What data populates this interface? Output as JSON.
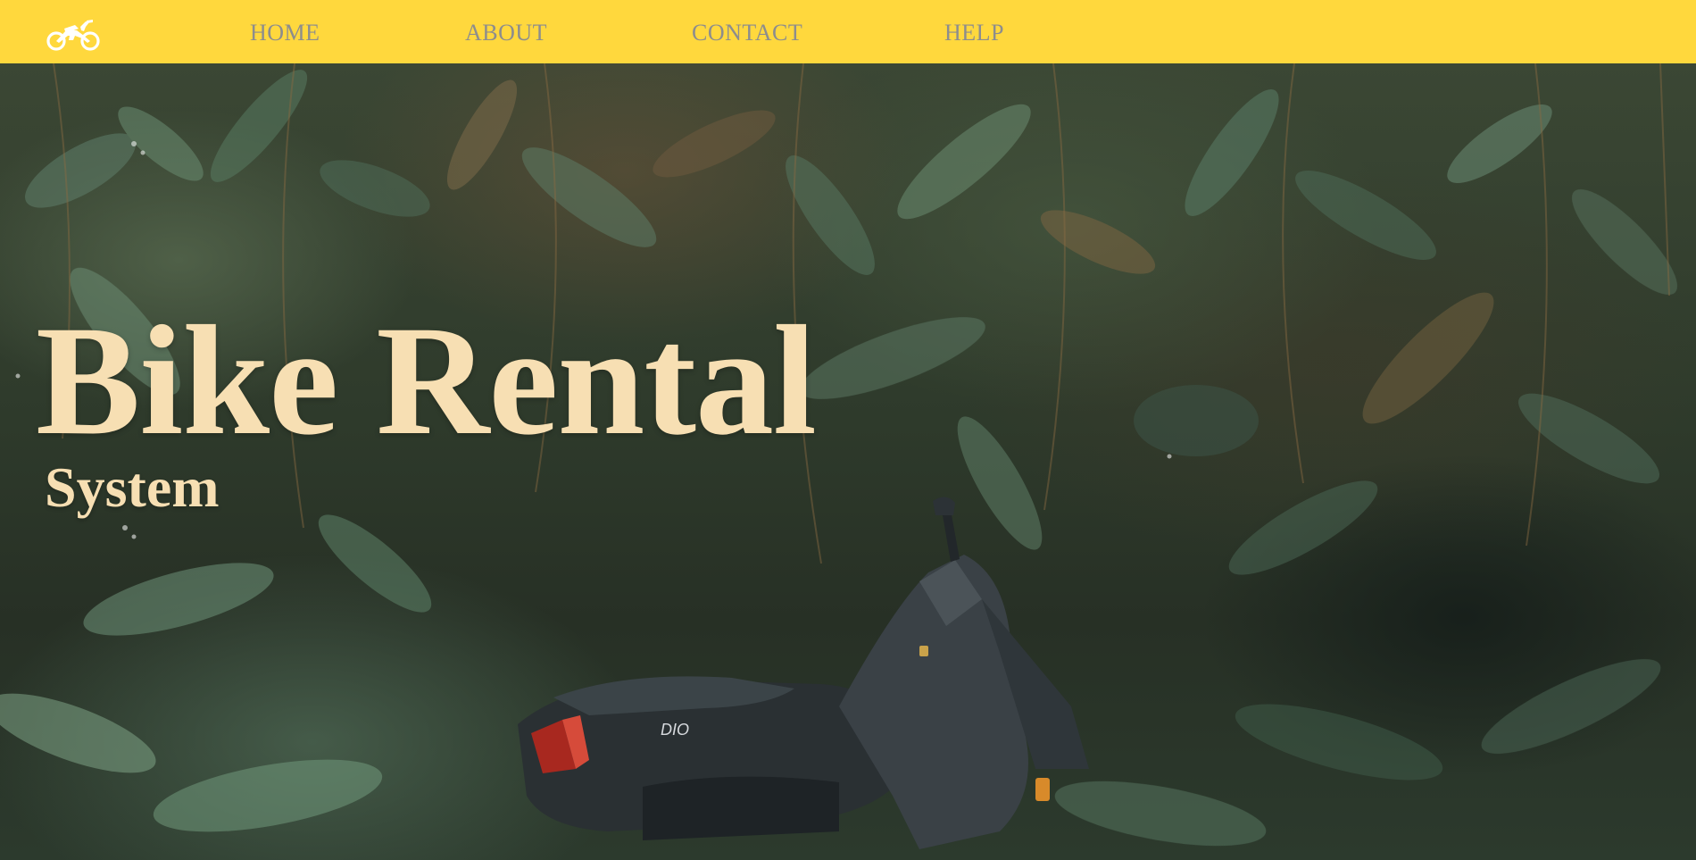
{
  "nav": {
    "logo_icon": "motorbike-icon",
    "items": [
      {
        "label": "HOME"
      },
      {
        "label": "ABOUT"
      },
      {
        "label": "CONTACT"
      },
      {
        "label": "HELP"
      }
    ]
  },
  "hero": {
    "title": "Bike Rental",
    "subtitle": "System",
    "background": "jungle-foliage-with-scooter-photo"
  },
  "colors": {
    "navbar_bg": "#ffd83d",
    "nav_text": "#8d8d8d",
    "hero_text": "#f7dfb3"
  }
}
